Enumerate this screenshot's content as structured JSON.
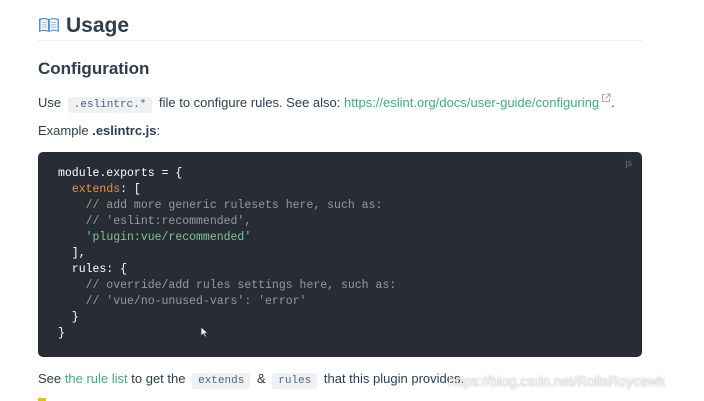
{
  "heading": {
    "icon": "open-book-icon",
    "title": "Usage"
  },
  "config": {
    "title": "Configuration",
    "line1_prefix": "Use",
    "line1_code": ".eslintrc.*",
    "line1_middle": "file to configure rules. See also:",
    "line1_link": "https://eslint.org/docs/user-guide/configuring",
    "line1_suffix": ".",
    "example_prefix": "Example",
    "example_file": ".eslintrc.js",
    "example_suffix": ":"
  },
  "codeblock": {
    "lang": "js",
    "lines": [
      [
        {
          "t": "punct",
          "v": "module.exports = {"
        }
      ],
      [
        {
          "t": "punct",
          "v": "  "
        },
        {
          "t": "prop",
          "v": "extends"
        },
        {
          "t": "punct",
          "v": ": ["
        }
      ],
      [
        {
          "t": "comment",
          "v": "    // add more generic rulesets here, such as:"
        }
      ],
      [
        {
          "t": "comment",
          "v": "    // 'eslint:recommended',"
        }
      ],
      [
        {
          "t": "punct",
          "v": "    "
        },
        {
          "t": "string",
          "v": "'plugin:vue/recommended'"
        }
      ],
      [
        {
          "t": "punct",
          "v": "  ],"
        }
      ],
      [
        {
          "t": "punct",
          "v": "  rules: {"
        }
      ],
      [
        {
          "t": "comment",
          "v": "    // override/add rules settings here, such as:"
        }
      ],
      [
        {
          "t": "comment",
          "v": "    // 'vue/no-unused-vars': 'error'"
        }
      ],
      [
        {
          "t": "punct",
          "v": "  }"
        }
      ],
      [
        {
          "t": "punct",
          "v": "}"
        }
      ]
    ]
  },
  "footer": {
    "prefix": "See",
    "link": "the rule list",
    "middle1": "to get the",
    "code1": "extends",
    "amp": "&",
    "code2": "rules",
    "suffix": "that this plugin provides."
  },
  "watermark": "https://blog.csdn.net/RollsRoycewk",
  "colors": {
    "accent": "#3eaf7c",
    "code_bg": "#282c34",
    "text": "#2c3e50"
  }
}
